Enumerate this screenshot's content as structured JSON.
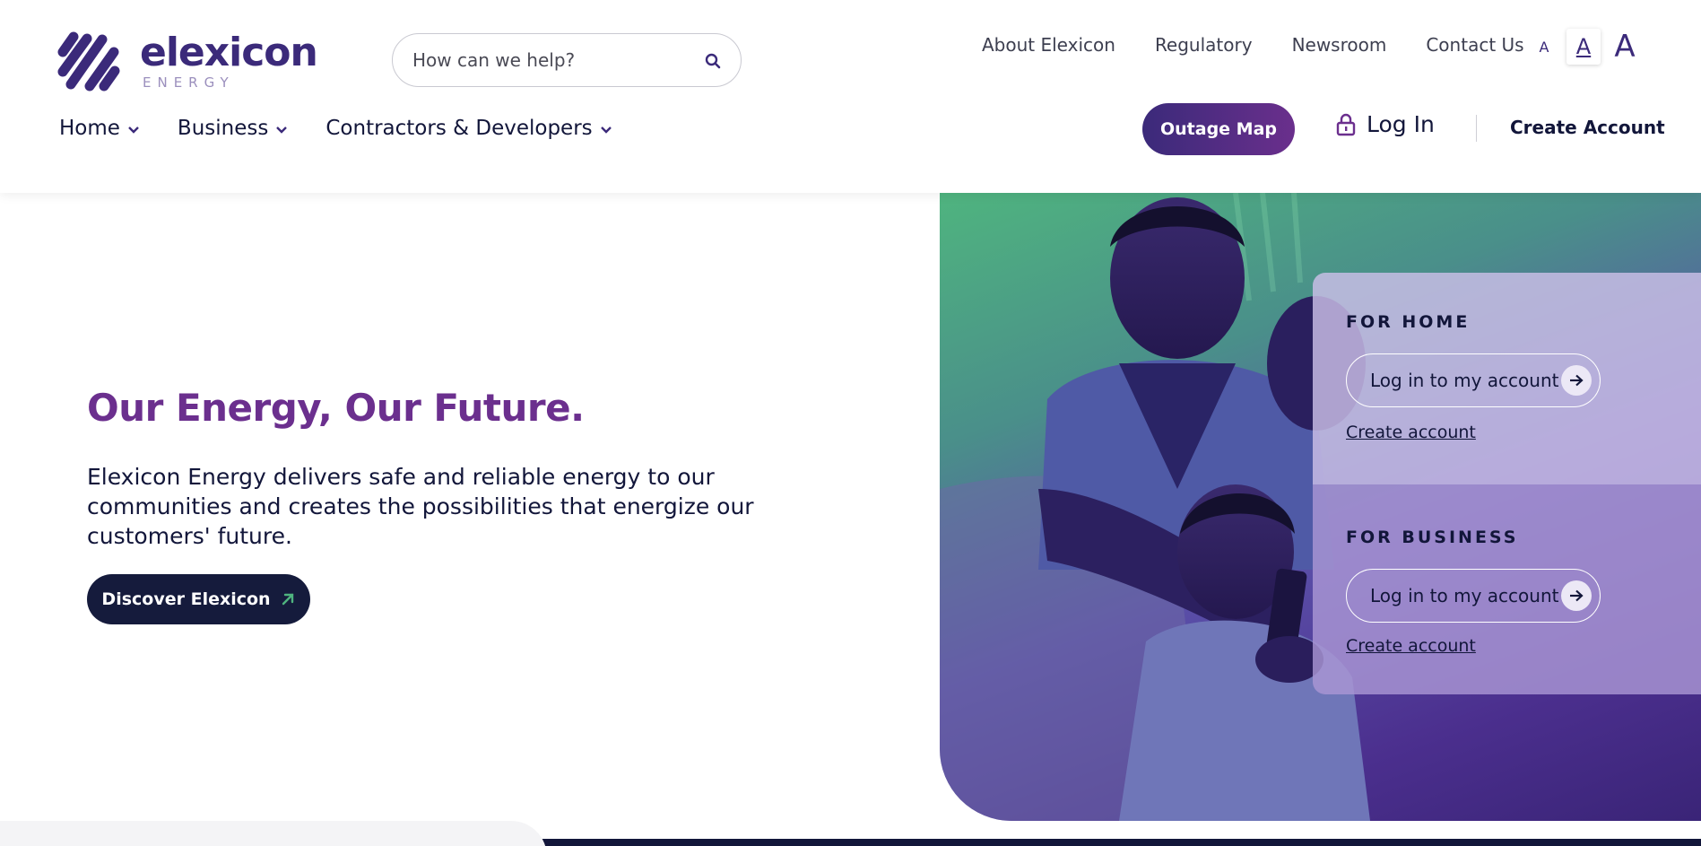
{
  "brand": {
    "name": "elexicon",
    "subline": "ENERGY",
    "primary_color": "#3b2a7a",
    "accent_color": "#6b2f8e",
    "dark_color": "#151b3c",
    "green_color": "#4fb47f"
  },
  "search": {
    "placeholder": "How can we help?",
    "icon": "search-icon"
  },
  "utility_nav": [
    "About Elexicon",
    "Regulatory",
    "Newsroom",
    "Contact Us"
  ],
  "font_size_controls": [
    "A",
    "A",
    "A"
  ],
  "main_nav": [
    {
      "label": "Home",
      "icon": "chevron-down-icon"
    },
    {
      "label": "Business",
      "icon": "chevron-down-icon"
    },
    {
      "label": "Contractors & Developers",
      "icon": "chevron-down-icon"
    }
  ],
  "header_actions": {
    "outage_map": "Outage Map",
    "log_in": "Log In",
    "log_in_icon": "lock-icon",
    "create_account": "Create Account"
  },
  "hero": {
    "title": "Our Energy, Our Future.",
    "description": "Elexicon Energy delivers safe and reliable energy to our communities and creates the possibilities that energize our customers' future.",
    "cta": "Discover Elexicon",
    "cta_icon": "arrow-up-right-icon"
  },
  "account_panel": {
    "home": {
      "label": "FOR HOME",
      "button": "Log in to my account",
      "link": "Create account"
    },
    "business": {
      "label": "FOR BUSINESS",
      "button": "Log in to my account",
      "link": "Create account"
    }
  }
}
